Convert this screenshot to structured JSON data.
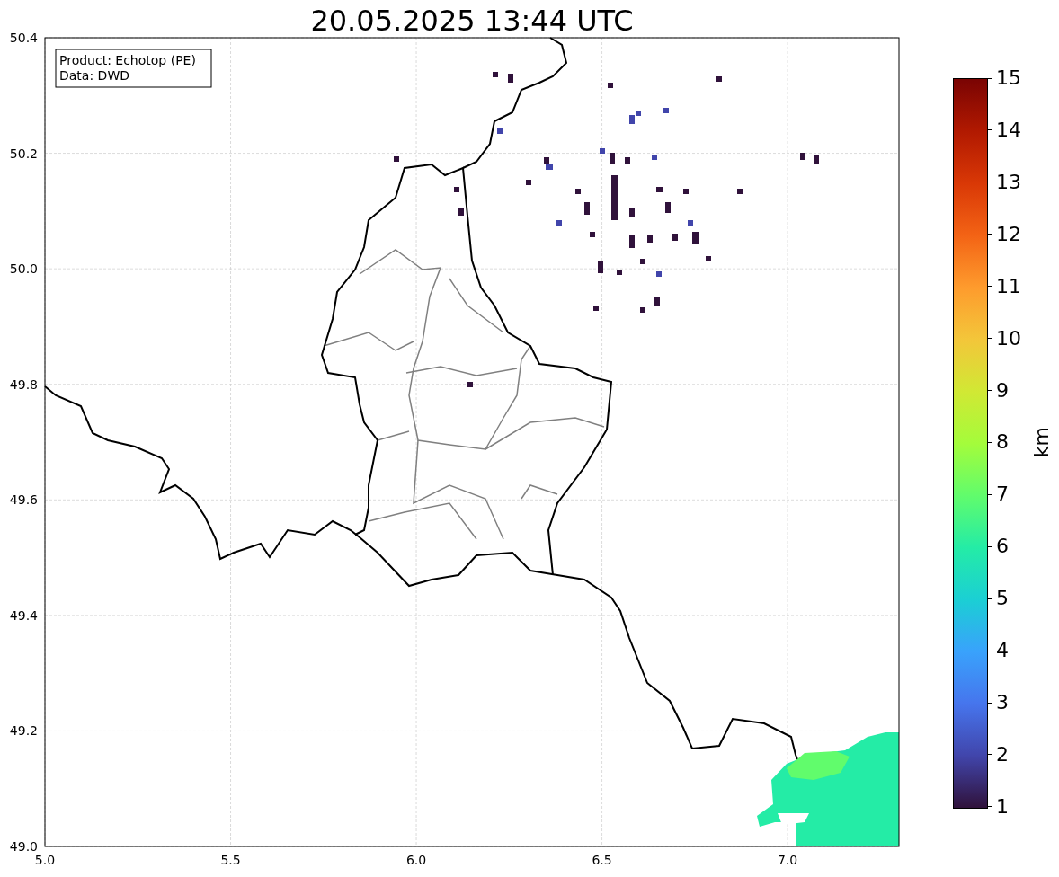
{
  "title": "20.05.2025 13:44 UTC",
  "legend_box": [
    "Product: Echotop (PE)",
    "Data: DWD"
  ],
  "x_ticks": [
    "5.0",
    "5.5",
    "6.0",
    "6.5",
    "7.0"
  ],
  "y_ticks": [
    "50.4",
    "50.2",
    "50.0",
    "49.8",
    "49.6",
    "49.4",
    "49.2",
    "49.0"
  ],
  "colorbar": {
    "label": "km",
    "ticks": [
      "15",
      "14",
      "13",
      "12",
      "11",
      "10",
      "9",
      "8",
      "7",
      "6",
      "5",
      "4",
      "3",
      "2",
      "1"
    ]
  }
}
